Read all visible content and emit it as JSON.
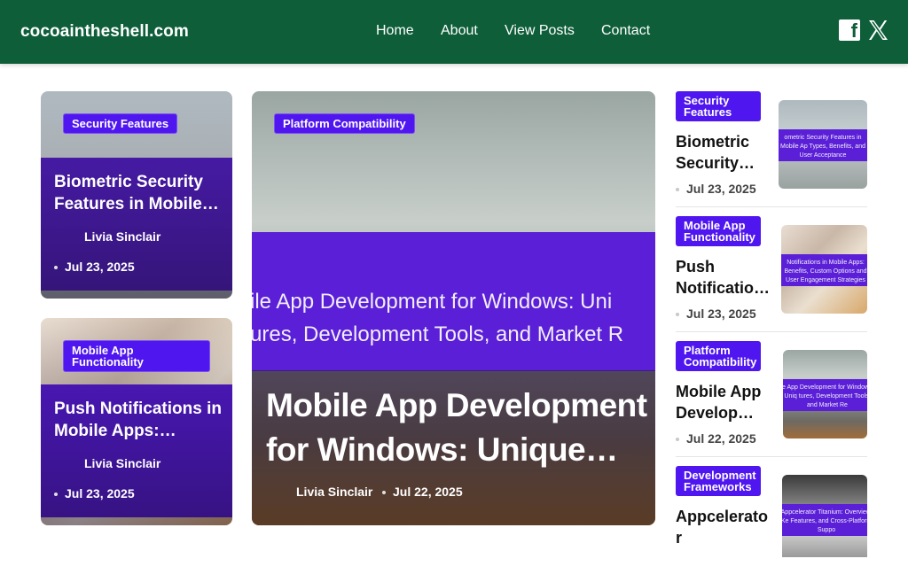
{
  "header": {
    "brand": "cocoaintheshell.com",
    "nav": [
      "Home",
      "About",
      "View Posts",
      "Contact"
    ]
  },
  "cards": {
    "left_top": {
      "category": "Security Features",
      "title": "Biometric Security Features in Mobile…",
      "author": "Livia Sinclair",
      "date": "Jul 23, 2025"
    },
    "left_bottom": {
      "category": "Mobile App Functionality",
      "title": "Push Notifications in Mobile Apps:…",
      "author": "Livia Sinclair",
      "date": "Jul 23, 2025"
    },
    "feature": {
      "category": "Platform Compatibility",
      "image_text_line1": "ile App Development for Windows: Uni",
      "image_text_line2": "ures, Development Tools, and Market R",
      "title": "Mobile App Development for Windows: Unique…",
      "author": "Livia Sinclair",
      "date": "Jul 22, 2025"
    }
  },
  "sidebar": [
    {
      "category": "Security Features",
      "title": "Biometric Security…",
      "date": "Jul 23, 2025",
      "thumb_text": "ometric Security Features in Mobile Ap Types, Benefits, and User Acceptance"
    },
    {
      "category": "Mobile App Functionality",
      "title": "Push Notificatio…",
      "date": "Jul 23, 2025",
      "thumb_text": "Notifications in Mobile Apps: Benefits, Custom Options and User Engagement Strategies"
    },
    {
      "category": "Platform Compatibility",
      "title": "Mobile App Develop…",
      "date": "Jul 22, 2025",
      "thumb_text": "le App Development for Windows: Uniq tures, Development Tools, and Market Re"
    },
    {
      "category": "Development Frameworks",
      "title": "Appcelerato r Titanium…",
      "date": "",
      "thumb_text": "Appcelerator Titanium: Overview, Ke Features, and Cross-Platform Suppo"
    }
  ],
  "colors": {
    "header_bg": "#0f5e3a",
    "accent": "#4f16f0",
    "band": "#5a1fd6"
  }
}
